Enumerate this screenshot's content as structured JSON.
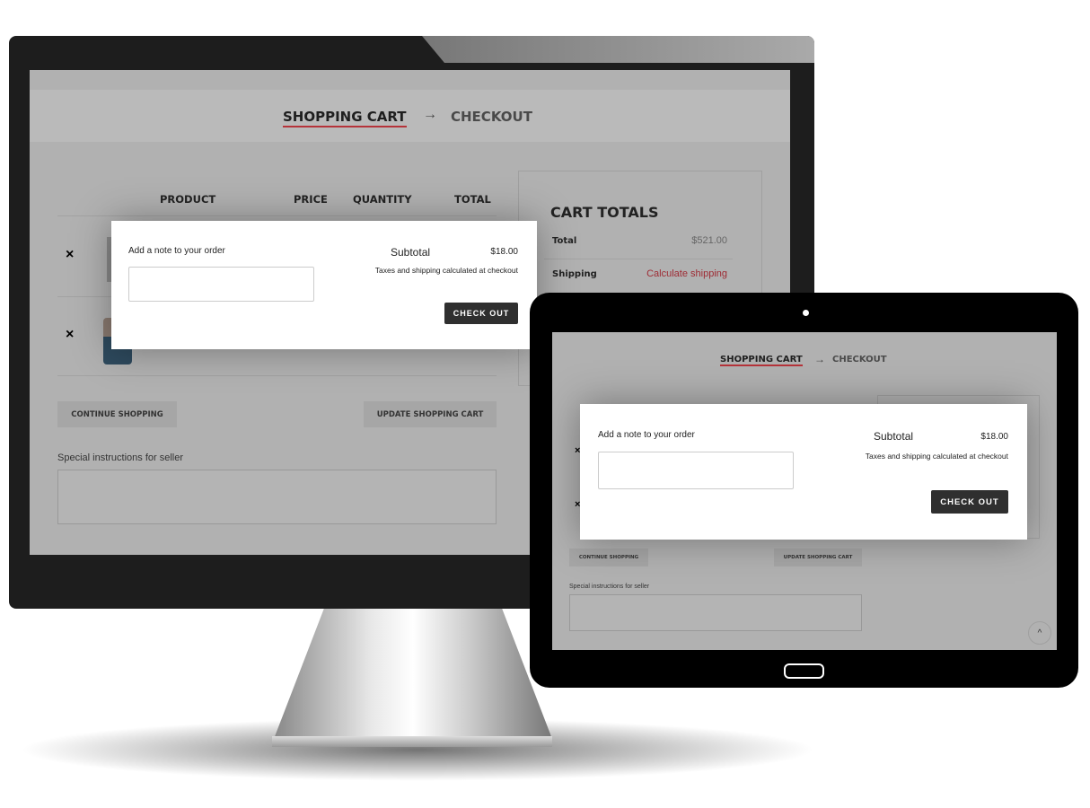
{
  "steps": {
    "cart": "SHOPPING CART",
    "arrow": "→",
    "checkout": "CHECKOUT"
  },
  "table": {
    "headers": [
      "PRODUCT",
      "PRICE",
      "QUANTITY",
      "TOTAL"
    ],
    "remove_icon": "×"
  },
  "buttons": {
    "continue": "CONTINUE SHOPPING",
    "update": "UPDATE SHOPPING CART",
    "checkout": "CHECK OUT"
  },
  "special_instructions": "Special instructions for seller",
  "cart_totals": {
    "title": "CART TOTALS",
    "total_label": "Total",
    "total_value": "$521.00",
    "shipping_label": "Shipping",
    "shipping_link": "Calculate shipping"
  },
  "popup": {
    "note_label": "Add a note to your order",
    "subtotal_label": "Subtotal",
    "subtotal_value": "$18.00",
    "taxes_note": "Taxes and shipping calculated at checkout"
  },
  "scroll_top_icon": "^",
  "colors": {
    "accent": "#b5333a",
    "link": "#9e2a33",
    "dark_button": "#2f2f2f"
  }
}
